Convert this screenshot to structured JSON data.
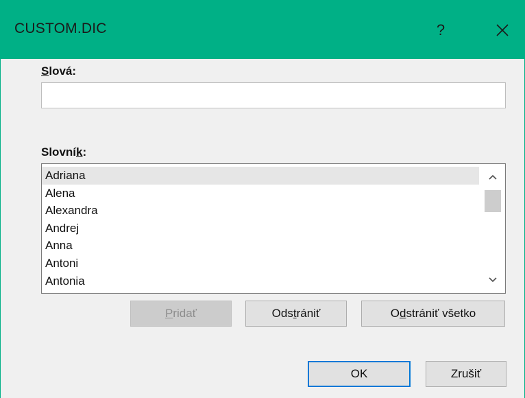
{
  "window": {
    "title": "CUSTOM.DIC",
    "help_label": "?"
  },
  "words": {
    "label_prefix": "",
    "label_mnemonic": "S",
    "label_suffix": "lová:",
    "value": ""
  },
  "dictionary": {
    "label_prefix": "Slovní",
    "label_mnemonic": "k",
    "label_suffix": ":",
    "items": [
      "Adriana",
      "Alena",
      "Alexandra",
      "Andrej",
      "Anna",
      "Antoni",
      "Antonia"
    ],
    "selected_index": 0
  },
  "buttons": {
    "add": {
      "pre": "",
      "mn": "P",
      "post": "ridať",
      "enabled": false
    },
    "remove": {
      "pre": "Ods",
      "mn": "t",
      "post": "rániť"
    },
    "remove_all": {
      "pre": "O",
      "mn": "d",
      "post": "strániť všetko"
    },
    "ok": "OK",
    "cancel": "Zrušiť"
  },
  "colors": {
    "accent": "#00b086",
    "focus": "#0078d7"
  }
}
